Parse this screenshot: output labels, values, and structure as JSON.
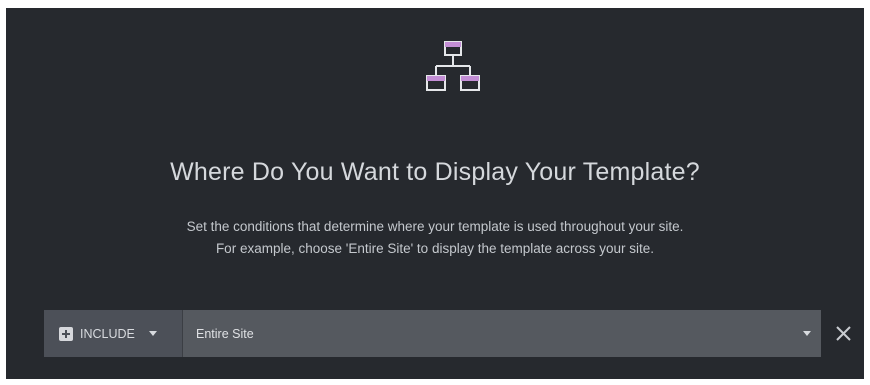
{
  "dialog": {
    "icon": "sitemap-icon",
    "title": "Where Do You Want to Display Your Template?",
    "description_line1": "Set the conditions that determine where your template is used throughout your site.",
    "description_line2": "For example, choose 'Entire Site' to display the template across your site."
  },
  "condition": {
    "include_icon": "plus-square-icon",
    "include_label": "INCLUDE",
    "scope_value": "Entire Site",
    "remove_icon": "close-icon"
  },
  "colors": {
    "panel_bg": "#26292e",
    "icon_accent": "#c38ed5",
    "icon_line": "#e5e7ea",
    "include_bg": "#4c5058",
    "scope_bg": "#55595f",
    "text": "#d5d8dc"
  }
}
